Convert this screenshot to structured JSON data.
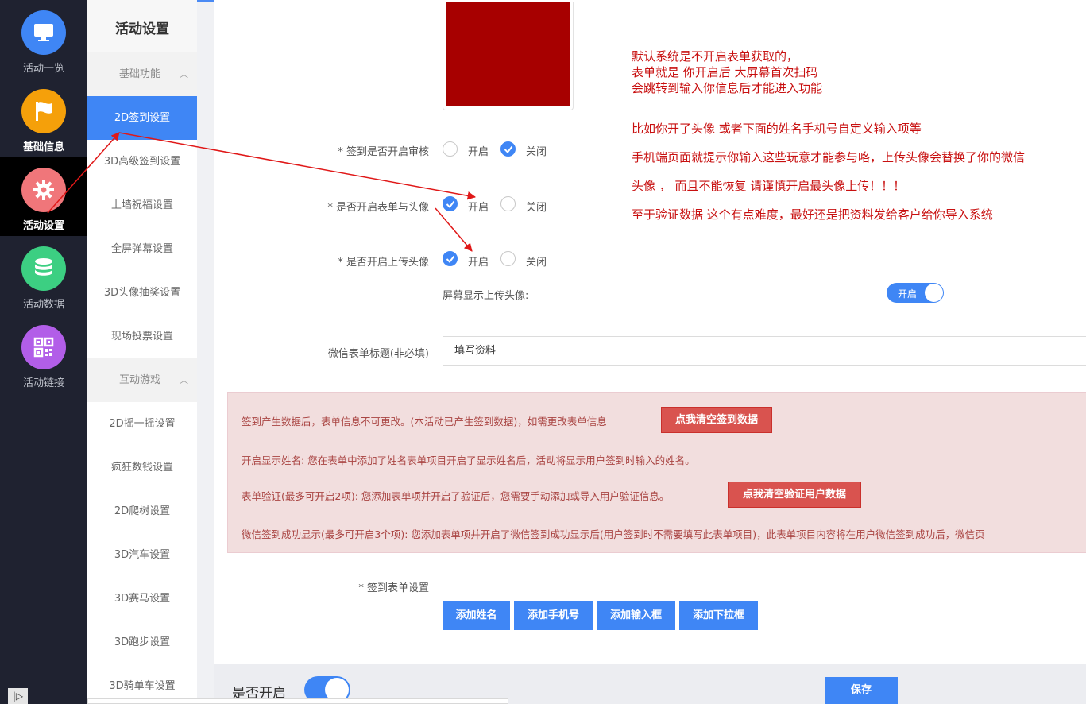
{
  "rail": {
    "items": [
      {
        "label": "活动一览",
        "color": "#3f86f5",
        "icon": "monitor-icon"
      },
      {
        "label": "基础信息",
        "color": "#f5a00a",
        "icon": "flag-icon"
      },
      {
        "label": "活动设置",
        "color": "#f0767a",
        "icon": "gear-icon"
      },
      {
        "label": "活动数据",
        "color": "#3ccf82",
        "icon": "database-icon"
      },
      {
        "label": "活动链接",
        "color": "#b25ee8",
        "icon": "qrcode-icon"
      }
    ]
  },
  "menu": {
    "title": "活动设置",
    "group1": "基础功能",
    "group2": "互动游戏",
    "items1": [
      "2D签到设置",
      "3D高级签到设置",
      "上墙祝福设置",
      "全屏弹幕设置",
      "3D头像抽奖设置",
      "现场投票设置"
    ],
    "items2": [
      "2D摇一摇设置",
      "疯狂数钱设置",
      "2D爬树设置",
      "3D汽车设置",
      "3D赛马设置",
      "3D跑步设置",
      "3D骑单车设置"
    ]
  },
  "notes": [
    "默认系统是不开启表单获取的，",
    "表单就是    你开启后    大屏幕首次扫码",
    "会跳转到输入你信息后才能进入功能",
    "比如你开了头像  或者下面的姓名手机号自定义输入项等",
    "手机端页面就提示你输入这些玩意才能参与咯，上传头像会替换了你的微信",
    "头像 ， 而且不能恢复  请谨慎开启最头像上传！！！",
    "至于验证数据  这个有点难度，最好还是把资料发给客户给你导入系统"
  ],
  "form": {
    "audit_label": "* 签到是否开启审核",
    "form_avatar_label": "* 是否开启表单与头像",
    "upload_avatar_label": "* 是否开启上传头像",
    "on": "开启",
    "off": "关闭",
    "screen_avatar_label": "屏幕显示上传头像:",
    "screen_avatar_switch": "开启",
    "wechat_title_label": "微信表单标题(非必填)",
    "wechat_title_value": "填写资料",
    "signin_form_label": "* 签到表单设置"
  },
  "alert": {
    "line1": "签到产生数据后，表单信息不可更改。(本活动已产生签到数据)，如需更改表单信息",
    "btn1": "点我清空签到数据",
    "line2": "开启显示姓名: 您在表单中添加了姓名表单项目开启了显示姓名后，活动将显示用户签到时输入的姓名。",
    "line3": "表单验证(最多可开启2项): 您添加表单项并开启了验证后，您需要手动添加或导入用户验证信息。",
    "btn2": "点我清空验证用户数据",
    "line4": "微信签到成功显示(最多可开启3个项): 您添加表单项并开启了微信签到成功显示后(用户签到时不需要填写此表单项目)，此表单项目内容将在用户微信签到成功后，微信页"
  },
  "buttons": [
    "添加姓名",
    "添加手机号",
    "添加输入框",
    "添加下拉框"
  ],
  "footer": {
    "enable_label": "是否开启",
    "save": "保存"
  }
}
